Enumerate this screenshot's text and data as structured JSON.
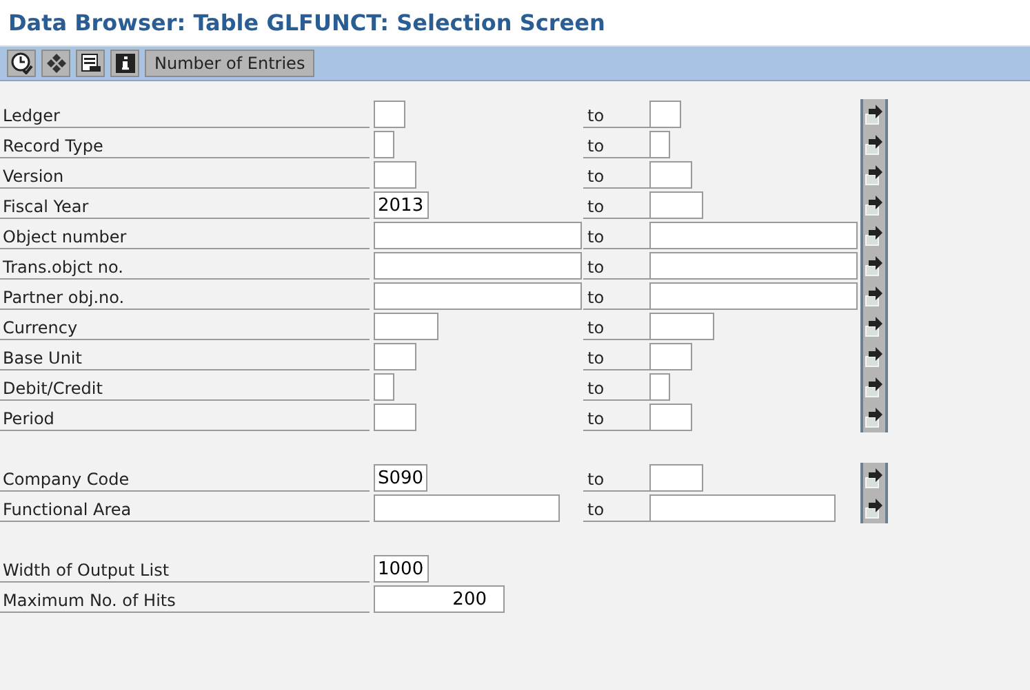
{
  "window": {
    "title": "Data Browser: Table GLFUNCT: Selection Screen"
  },
  "toolbar": {
    "buttons": [
      {
        "kind": "execute"
      },
      {
        "kind": "other"
      },
      {
        "kind": "layout"
      },
      {
        "kind": "info"
      },
      {
        "kind": "text",
        "label": "Number of Entries"
      }
    ]
  },
  "groups": [
    {
      "rows": [
        {
          "kind": "range",
          "label": "Ledger",
          "value": "",
          "to_label": "to",
          "to_value": ""
        },
        {
          "kind": "range",
          "label": "Record Type",
          "value": "",
          "to_label": "to",
          "to_value": ""
        },
        {
          "kind": "range",
          "label": "Version",
          "value": "",
          "to_label": "to",
          "to_value": ""
        },
        {
          "kind": "range",
          "label": "Fiscal Year",
          "value": "2013",
          "to_label": "to",
          "to_value": ""
        },
        {
          "kind": "range",
          "label": "Object number",
          "value": "",
          "to_label": "to",
          "to_value": ""
        },
        {
          "kind": "range",
          "label": "Trans.objct no.",
          "value": "",
          "to_label": "to",
          "to_value": ""
        },
        {
          "kind": "range",
          "label": "Partner obj.no.",
          "value": "",
          "to_label": "to",
          "to_value": ""
        },
        {
          "kind": "range",
          "label": "Currency",
          "value": "",
          "to_label": "to",
          "to_value": ""
        },
        {
          "kind": "range",
          "label": "Base Unit",
          "value": "",
          "to_label": "to",
          "to_value": ""
        },
        {
          "kind": "range",
          "label": "Debit/Credit",
          "value": "",
          "to_label": "to",
          "to_value": ""
        },
        {
          "kind": "range",
          "label": "Period",
          "value": "",
          "to_label": "to",
          "to_value": ""
        }
      ]
    },
    {
      "rows": [
        {
          "kind": "range",
          "label": "Company Code",
          "value": "S090",
          "to_label": "to",
          "to_value": ""
        },
        {
          "kind": "range",
          "label": "Functional Area",
          "value": "",
          "to_label": "to",
          "to_value": ""
        }
      ]
    },
    {
      "rows": [
        {
          "kind": "single",
          "label": "Width of Output List",
          "value": "1000"
        },
        {
          "kind": "number",
          "label": "Maximum No. of Hits",
          "value": "200"
        }
      ]
    }
  ]
}
